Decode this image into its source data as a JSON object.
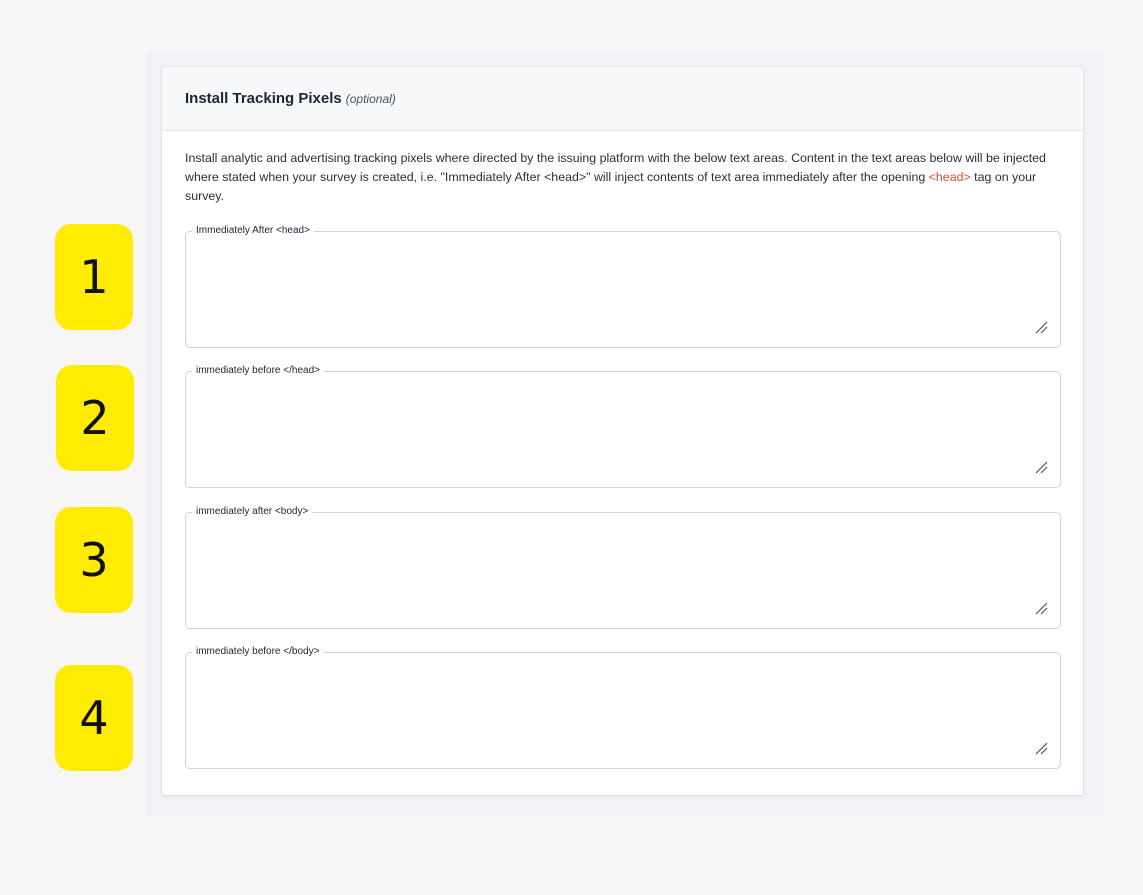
{
  "panel": {
    "title": "Install Tracking Pixels",
    "title_optional": "(optional)",
    "description_part1": "Install analytic and advertising tracking pixels where directed by the issuing platform with the below text areas. Content in the text areas below will be injected where stated when your survey is created, i.e. \"Immediately After <head>\" will inject contents of text area immediately after the opening ",
    "description_code": "<head>",
    "description_part2": " tag on your survey."
  },
  "fields": [
    {
      "label": "Immediately After <head>",
      "value": ""
    },
    {
      "label": "immediately before </head>",
      "value": ""
    },
    {
      "label": "immediately after <body>",
      "value": ""
    },
    {
      "label": "immediately before </body>",
      "value": ""
    }
  ],
  "badges": [
    "1",
    "2",
    "3",
    "4"
  ],
  "colors": {
    "badge": "#ffec00",
    "code_highlight": "#e8492f",
    "page_background": "#f7f5f6"
  },
  "icons": {
    "resize": "resize-grip-icon"
  }
}
